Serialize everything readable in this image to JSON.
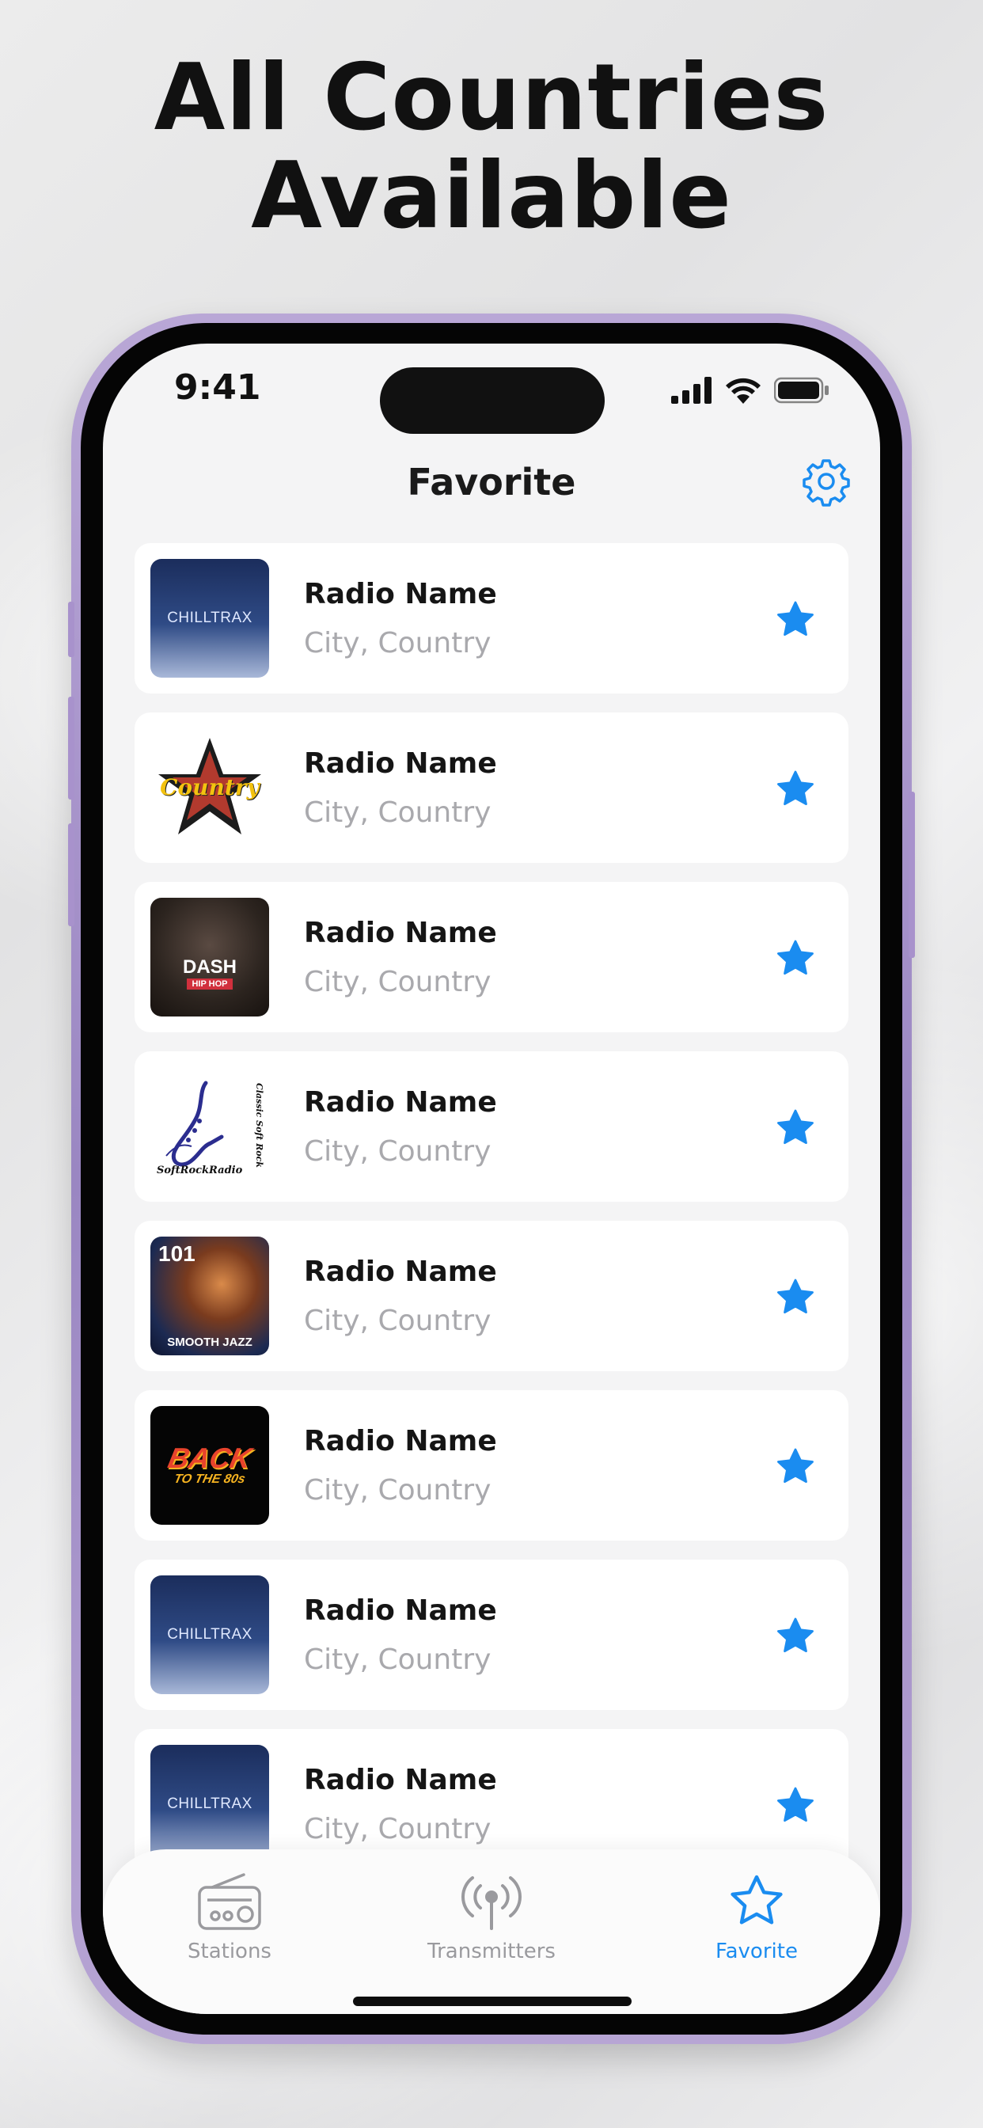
{
  "headline": [
    "All Countries",
    "Available"
  ],
  "status_bar": {
    "time": "9:41"
  },
  "nav": {
    "title": "Favorite",
    "settings_icon": "gear-icon"
  },
  "stations": [
    {
      "name": "Radio Name",
      "location": "City, Country",
      "logo": "chilltrax",
      "logo_text": "CHILLTRAX",
      "favorited": true
    },
    {
      "name": "Radio Name",
      "location": "City, Country",
      "logo": "country",
      "logo_text": "Country",
      "favorited": true
    },
    {
      "name": "Radio Name",
      "location": "City, Country",
      "logo": "dash-hiphop",
      "logo_text": "DASH",
      "logo_subtext": "HIP HOP",
      "favorited": true
    },
    {
      "name": "Radio Name",
      "location": "City, Country",
      "logo": "softrock",
      "logo_text": "SoftRockRadio",
      "logo_subtext": "Classic Soft Rock",
      "favorited": true
    },
    {
      "name": "Radio Name",
      "location": "City, Country",
      "logo": "smoothjazz",
      "logo_text": "101",
      "logo_subtext": "SMOOTH JAZZ",
      "favorited": true
    },
    {
      "name": "Radio Name",
      "location": "City, Country",
      "logo": "back80s",
      "logo_text": "BACK",
      "logo_subtext": "TO THE 80s",
      "favorited": true
    },
    {
      "name": "Radio Name",
      "location": "City, Country",
      "logo": "chilltrax",
      "logo_text": "CHILLTRAX",
      "favorited": true
    },
    {
      "name": "Radio Name",
      "location": "City, Country",
      "logo": "chilltrax",
      "logo_text": "CHILLTRAX",
      "favorited": true
    }
  ],
  "tabs": [
    {
      "label": "Stations",
      "icon": "radio-icon",
      "active": false
    },
    {
      "label": "Transmitters",
      "icon": "antenna-icon",
      "active": false
    },
    {
      "label": "Favorite",
      "icon": "star-icon",
      "active": true
    }
  ],
  "colors": {
    "accent": "#1A8CF0",
    "star": "#1A8CF0",
    "muted_text": "#A9A9AD",
    "frame": "#A892CC"
  }
}
